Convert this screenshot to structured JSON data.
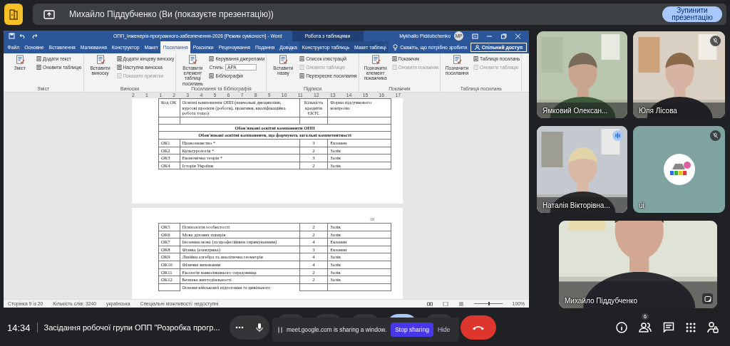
{
  "presenting_bar": {
    "text": "Михайло Піддубченко (Ви (показуєте презентацію))",
    "button": "Зупинити презентацію"
  },
  "word": {
    "title": "ОПП_Інженерія-програмного-забезпечення-2026 [Режим сумісності] - Word",
    "context_tab": "Робота з таблицями",
    "user": "Mykhailo Piddubchenko",
    "avatar": "MP",
    "tabs": [
      {
        "label": "Файл",
        "selected": false
      },
      {
        "label": "Основне",
        "selected": false
      },
      {
        "label": "Вставлення",
        "selected": false
      },
      {
        "label": "Малювання",
        "selected": false
      },
      {
        "label": "Конструктор",
        "selected": false
      },
      {
        "label": "Макет",
        "selected": false
      },
      {
        "label": "Посилання",
        "selected": true
      },
      {
        "label": "Розсилки",
        "selected": false
      },
      {
        "label": "Рецензування",
        "selected": false
      },
      {
        "label": "Подання",
        "selected": false
      },
      {
        "label": "Довідка",
        "selected": false
      },
      {
        "label": "Конструктор таблиць",
        "selected": false
      },
      {
        "label": "Макет таблиці",
        "selected": false
      }
    ],
    "tell_me": "Скажіть, що потрібно зробити",
    "share": "Спільний доступ",
    "ribbon": [
      {
        "label": "Зміст",
        "items": [
          {
            "kind": "large",
            "label": "Зміст",
            "disabled": false
          },
          {
            "kind": "small",
            "label": "Додати текст",
            "disabled": false
          },
          {
            "kind": "small",
            "label": "Оновити таблицю",
            "disabled": false
          }
        ]
      },
      {
        "label": "Виноски",
        "items": [
          {
            "kind": "large",
            "label": "Вставити виноску",
            "disabled": false
          },
          {
            "kind": "small",
            "label": "Додати кінцеву виноску",
            "disabled": false
          },
          {
            "kind": "small",
            "label": "Наступна виноска",
            "disabled": false
          },
          {
            "kind": "small",
            "label": "Показати примітки",
            "disabled": true
          }
        ]
      },
      {
        "label": "Посилання та бібліографія",
        "items": [
          {
            "kind": "large",
            "label": "Вставити елемент таблиці посилань",
            "disabled": false
          },
          {
            "kind": "small",
            "label": "Керування джерелами",
            "disabled": false
          },
          {
            "kind": "select",
            "label": "Стиль:",
            "value": "APA",
            "disabled": false
          },
          {
            "kind": "small",
            "label": "Бібліографія",
            "disabled": false
          }
        ]
      },
      {
        "label": "Підписи",
        "items": [
          {
            "kind": "large",
            "label": "Вставити назву",
            "disabled": false
          },
          {
            "kind": "small",
            "label": "Список ілюстрацій",
            "disabled": false
          },
          {
            "kind": "small",
            "label": "Оновити таблицю",
            "disabled": true
          },
          {
            "kind": "small",
            "label": "Перехресне посилання",
            "disabled": false
          }
        ]
      },
      {
        "label": "Покажчик",
        "items": [
          {
            "kind": "large",
            "label": "Позначити елемент покажчика",
            "disabled": false
          },
          {
            "kind": "small",
            "label": "Покажчик",
            "disabled": false
          },
          {
            "kind": "small",
            "label": "Оновити покажчик",
            "disabled": true
          }
        ]
      },
      {
        "label": "Таблиця посилань",
        "items": [
          {
            "kind": "large",
            "label": "Позначити посилання",
            "disabled": false
          },
          {
            "kind": "small",
            "label": "Таблиця посилань",
            "disabled": false
          },
          {
            "kind": "small",
            "label": "Оновити таблицю",
            "disabled": true
          }
        ]
      }
    ],
    "ruler": [
      "2",
      "1",
      "1",
      "2",
      "3",
      "4",
      "5",
      "6",
      "7",
      "8",
      "9",
      "10",
      "11",
      "12",
      "13",
      "14",
      "15",
      "16",
      "17"
    ],
    "pages": [
      {
        "rows": [
          {
            "kind": "header",
            "cells": [
              "Код ОК",
              "Освітні компоненти ОПП (навчальні дисципліни, курсові проєкти (роботи), практики, кваліфікаційна робота тощо)",
              "Кількість кредитів ЄКТС",
              "Форма підсумкового контролю"
            ]
          },
          {
            "kind": "blank"
          },
          {
            "kind": "section",
            "text": "Обов'язкові освітні компоненти ОПП"
          },
          {
            "kind": "section",
            "text": "Обов'язкові освітні компоненти, що формують загальні компетентності"
          },
          {
            "kind": "course",
            "cells": [
              "ОК1",
              "Правознавство *",
              "3",
              "Екзамен"
            ]
          },
          {
            "kind": "course",
            "cells": [
              "ОК2",
              "Культурологія *",
              "2",
              "Залік"
            ]
          },
          {
            "kind": "course",
            "cells": [
              "ОК3",
              "Економічна теорія *",
              "3",
              "Залік"
            ]
          },
          {
            "kind": "course",
            "cells": [
              "ОК4",
              "Історія України",
              "2",
              "Залік"
            ]
          }
        ]
      },
      {
        "page_number": "10",
        "rows": [
          {
            "kind": "course",
            "cells": [
              "ОК5",
              "Психологія особистості",
              "2",
              "Залік"
            ]
          },
          {
            "kind": "course",
            "cells": [
              "ОК6",
              "Мова ділових паперів",
              "2",
              "Залік"
            ]
          },
          {
            "kind": "course",
            "cells": [
              "ОК7",
              "Іноземна мова (за професійним спрямуванням)",
              "4",
              "Екзамен"
            ]
          },
          {
            "kind": "course",
            "cells": [
              "ОК8",
              "Фізика (електрика)",
              "3",
              "Екзамен"
            ]
          },
          {
            "kind": "course",
            "cells": [
              "ОК9",
              "Лінійна алгебра та аналітична геометрія",
              "4",
              "Залік"
            ]
          },
          {
            "kind": "course",
            "cells": [
              "ОК10",
              "Фізичне виховання",
              "4",
              "Залік"
            ]
          },
          {
            "kind": "course",
            "cells": [
              "ОК11",
              "Екологія навколишнього середовища",
              "2",
              "Залік"
            ]
          },
          {
            "kind": "course",
            "cells": [
              "ОК12",
              "Безпека життєдіяльності",
              "2",
              "Залік"
            ]
          },
          {
            "kind": "partial",
            "text": "Основи військової підготовки та цивільного"
          }
        ]
      }
    ],
    "status": {
      "page": "Сторінка 9 із 20",
      "words": "Кількість слів: 3240",
      "language": "українська",
      "accessibility": "Спеціальні можливості: недоступні",
      "zoom": {
        "level": 0.5,
        "reading": "100%"
      }
    }
  },
  "tiles": [
    {
      "name": "Ямковий Олексан...",
      "kind": "video",
      "muted": false,
      "speaking": false
    },
    {
      "name": "Юля Лісова",
      "kind": "video",
      "muted": true,
      "speaking": false
    },
    {
      "name": "Наталія Вікторівна...",
      "kind": "video",
      "muted": false,
      "speaking": true
    },
    {
      "name": "ui",
      "kind": "avatar",
      "muted": true,
      "speaking": false
    },
    {
      "name": "Михайло Піддубченко",
      "kind": "self",
      "muted": false,
      "speaking": false
    }
  ],
  "bottom": {
    "time": "14:34",
    "meeting": "Засідання робочої групи ОПП \"Розробка прогр...",
    "toast": {
      "text": "meet.google.com is sharing a window.",
      "stop": "Stop sharing",
      "hide": "Hide"
    },
    "participants_badge": "6"
  }
}
